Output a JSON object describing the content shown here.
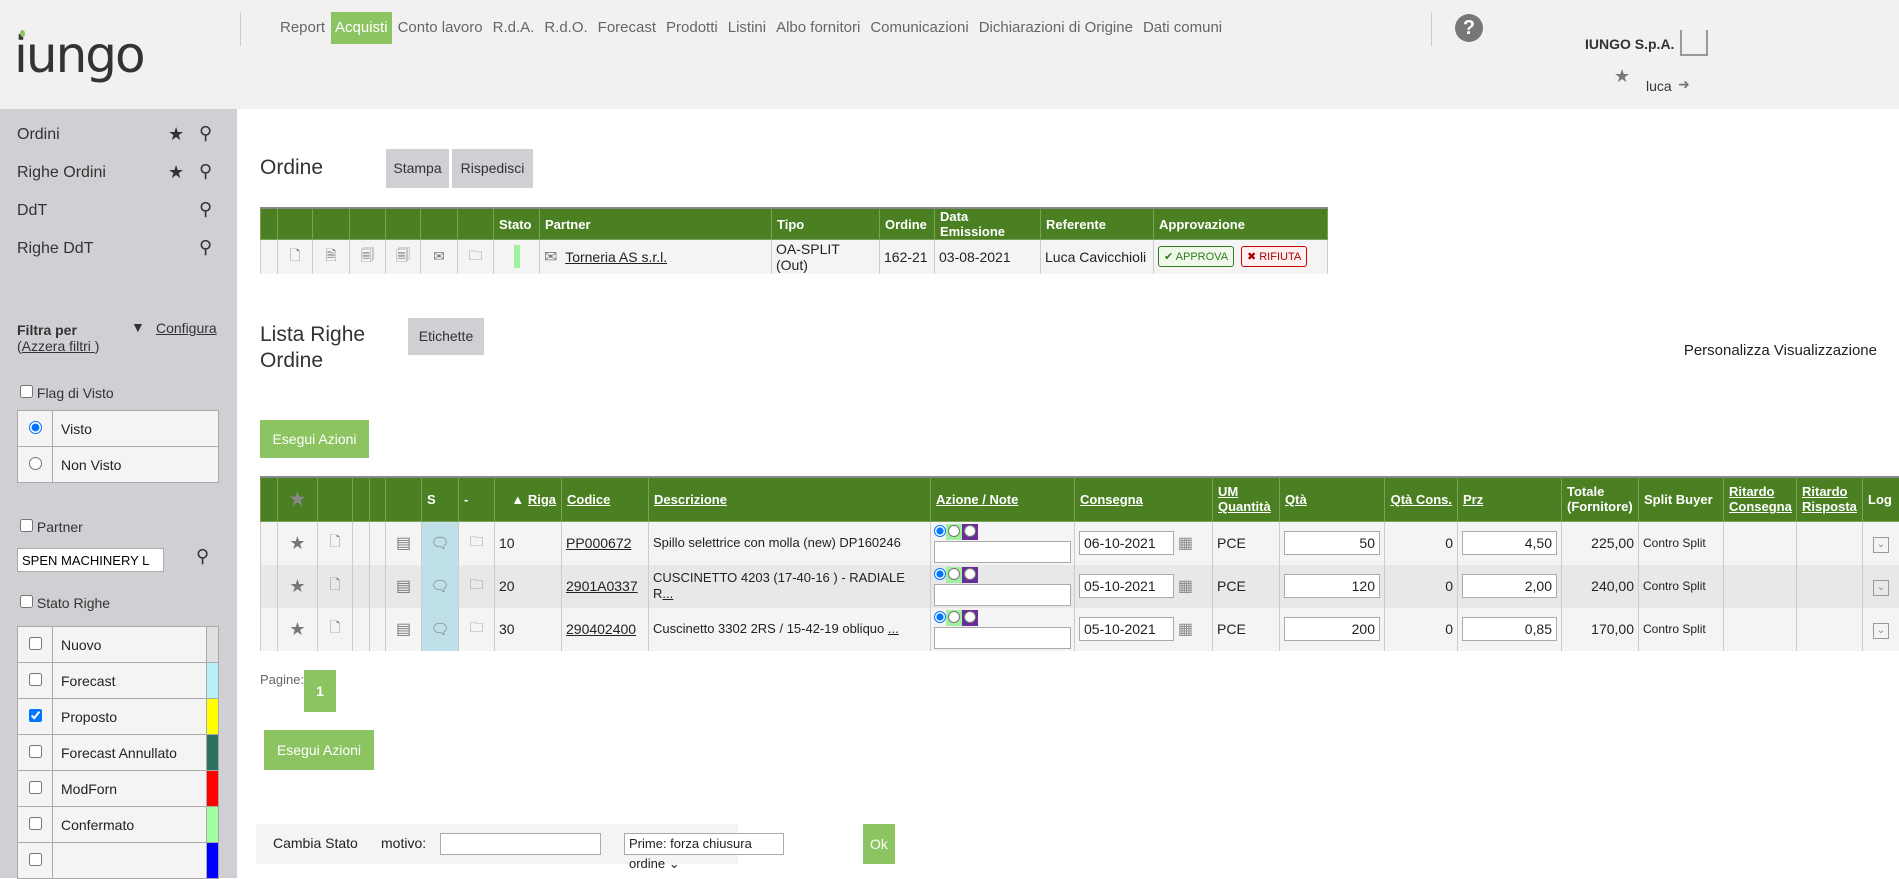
{
  "header": {
    "logo": "iungo",
    "nav": [
      "Report",
      "Acquisti",
      "Conto lavoro",
      "R.d.A.",
      "R.d.O.",
      "Forecast",
      "Prodotti",
      "Listini",
      "Albo fornitori",
      "Comunicazioni",
      "Dichiarazioni di Origine",
      "Dati comuni"
    ],
    "active_nav": "Acquisti",
    "company": "IUNGO S.p.A.",
    "user": "luca"
  },
  "sidebar": {
    "items": [
      "Ordini",
      "Righe Ordini",
      "DdT",
      "Righe DdT"
    ],
    "filter_title": "Filtra per",
    "reset_filters": "Azzera filtri ",
    "configure": "Configura",
    "flag_visto": "Flag di Visto",
    "visto_options": [
      {
        "label": "Visto",
        "selected": true
      },
      {
        "label": "Non Visto",
        "selected": false
      }
    ],
    "partner_label": "Partner",
    "partner_value": "SPEN MACHINERY L",
    "stato_righe": "Stato Righe",
    "stati": [
      {
        "label": "Nuovo",
        "checked": false,
        "color": "#e0e0e0"
      },
      {
        "label": "Forecast",
        "checked": false,
        "color": "#b8f0fa"
      },
      {
        "label": "Proposto",
        "checked": true,
        "color": "#ffff00"
      },
      {
        "label": "Forecast Annullato",
        "checked": false,
        "color": "#2e7060"
      },
      {
        "label": "ModForn",
        "checked": false,
        "color": "#ff0000"
      },
      {
        "label": "Confermato",
        "checked": false,
        "color": "#a0ffa0"
      },
      {
        "label": "",
        "checked": false,
        "color": "#0000ff"
      }
    ]
  },
  "order": {
    "title": "Ordine",
    "print": "Stampa",
    "resend": "Rispedisci",
    "headers": [
      "Stato",
      "Partner",
      "Tipo",
      "Ordine",
      "Data Emissione",
      "Referente",
      "Approvazione"
    ],
    "stato_color": "#a0f0a0",
    "partner": "Torneria AS s.r.l.",
    "tipo": "OA-SPLIT (Out)",
    "numero": "162-21",
    "data": "03-08-2021",
    "referente": "Luca Cavicchioli",
    "approve": "APPROVA",
    "reject": "RIFIUTA"
  },
  "lines": {
    "title": "Lista Righe Ordine",
    "labels": "Etichette",
    "customize": "Personalizza Visualizzazione",
    "execute": "Esegui Azioni",
    "headers": {
      "s": "S",
      "dash": "-",
      "riga": "Riga",
      "codice": "Codice",
      "descrizione": "Descrizione",
      "azione": "Azione / Note",
      "consegna": "Consegna",
      "um": "UM Quantità",
      "qta": "Qtà",
      "qta_cons": "Qtà Cons.",
      "prz": "Prz",
      "totale": "Totale (Fornitore)",
      "split": "Split Buyer",
      "rit_cons": "Ritardo Consegna",
      "rit_risp": "Ritardo Risposta",
      "log": "Log"
    },
    "rows": [
      {
        "riga": "10",
        "codice": "PP000672",
        "descrizione": "Spillo selettrice con molla (new) DP160246",
        "more": "",
        "consegna": "06-10-2021",
        "um": "PCE",
        "qta": "50",
        "qta_cons": "0",
        "prz": "4,50",
        "totale": "225,00",
        "split": "Contro Split"
      },
      {
        "riga": "20",
        "codice": "2901A0337",
        "descrizione": "CUSCINETTO 4203 (17-40-16 ) - RADIALE R",
        "more": "...",
        "consegna": "05-10-2021",
        "um": "PCE",
        "qta": "120",
        "qta_cons": "0",
        "prz": "2,00",
        "totale": "240,00",
        "split": "Contro Split"
      },
      {
        "riga": "30",
        "codice": "290402400",
        "descrizione": "Cuscinetto 3302 2RS / 15-42-19 obliquo ",
        "more": "...",
        "consegna": "05-10-2021",
        "um": "PCE",
        "qta": "200",
        "qta_cons": "0",
        "prz": "0,85",
        "totale": "170,00",
        "split": "Contro Split"
      }
    ],
    "pages_label": "Pagine:",
    "page": "1"
  },
  "change_state": {
    "label": "Cambia Stato",
    "motivo": "motivo:",
    "motivo_value": "",
    "select": "Prime: forza chiusura ordine",
    "ok": "Ok"
  }
}
